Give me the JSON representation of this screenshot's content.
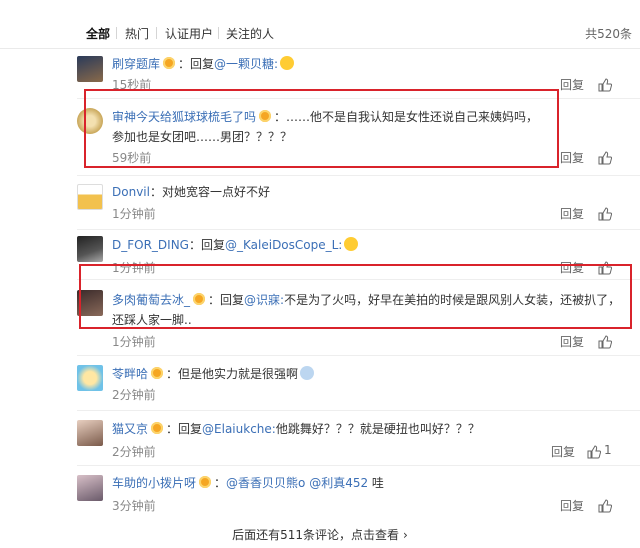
{
  "tabs": [
    {
      "label": "全部",
      "active": true
    },
    {
      "label": "热门",
      "active": false
    },
    {
      "label": "认证用户",
      "active": false
    },
    {
      "label": "关注的人",
      "active": false
    }
  ],
  "total_label": "共520条",
  "reply_label": "回复",
  "more_label": "后面还有511条评论，点击查看",
  "more_arrow": "›",
  "comments": [
    {
      "user": "刷穿题库",
      "body_prefix": "：回复",
      "mention": "@一颗贝糖:",
      "body_suffix": "",
      "time": "15秒前"
    },
    {
      "user": "审神今天给狐球球梳毛了吗",
      "body_prefix": "：……他不是自我认知是女性还说自己来姨妈吗，参加也是女团吧……男团？？？？",
      "mention": "",
      "body_suffix": "",
      "time": "59秒前"
    },
    {
      "user": "Donvil",
      "body_prefix": "：对她宽容一点好不好",
      "mention": "",
      "body_suffix": "",
      "time": "1分钟前"
    },
    {
      "user": "D_FOR_DING",
      "body_prefix": "：回复",
      "mention": "@_KaleiDosCope_L:",
      "body_suffix": "",
      "time": "1分钟前"
    },
    {
      "user": "多肉葡萄去冰_",
      "body_prefix": "：回复",
      "mention": "@识寐:",
      "body_suffix": "不是为了火吗，好早在美拍的时候是跟风别人女装，还被扒了，还踩人家一脚..",
      "time": "1分钟前"
    },
    {
      "user": "苓畔哈",
      "body_prefix": "：但是他实力就是很强啊",
      "mention": "",
      "body_suffix": "",
      "time": "2分钟前"
    },
    {
      "user": "猫又京",
      "body_prefix": "：回复",
      "mention": "@Elaiukche:",
      "body_suffix": "他跳舞好？？？就是硬扭也叫好？？？",
      "time": "2分钟前",
      "likes": "1"
    },
    {
      "user": "车助的小拨片呀",
      "body_prefix": "：",
      "mention": "@香香贝贝熊o @利真452",
      "body_suffix": "哇",
      "time": "3分钟前"
    }
  ],
  "colors": {
    "link": "#3b6fb6",
    "highlight_box": "#d9232b",
    "badge": "#f5a623"
  }
}
